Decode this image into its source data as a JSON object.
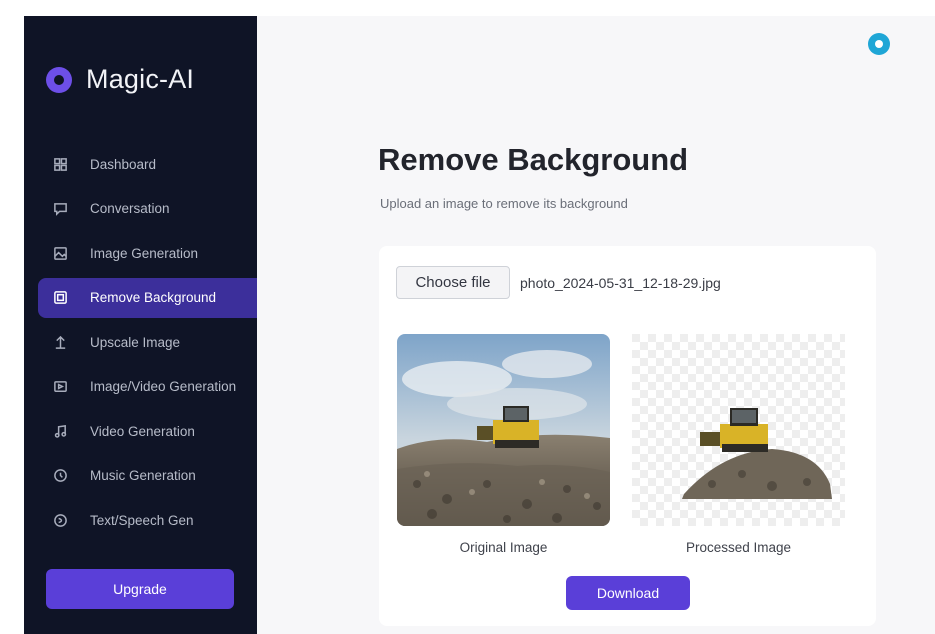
{
  "app": {
    "name": "Magic-AI",
    "logo_icon": "magic-ai-logo-icon"
  },
  "sidebar": {
    "items": [
      {
        "label": "Dashboard",
        "icon": "grid-icon",
        "active": false
      },
      {
        "label": "Conversation",
        "icon": "chat-icon",
        "active": false
      },
      {
        "label": "Image Generation",
        "icon": "image-icon",
        "active": false
      },
      {
        "label": "Remove Background",
        "icon": "image-frame-icon",
        "active": true
      },
      {
        "label": "Upscale Image",
        "icon": "upload-arrow-icon",
        "active": false
      },
      {
        "label": "Image/Video Generation",
        "icon": "video-frame-icon",
        "active": false
      },
      {
        "label": "Video Generation",
        "icon": "music-note-icon",
        "active": false
      },
      {
        "label": "Music Generation",
        "icon": "clock-icon",
        "active": false
      },
      {
        "label": "Text/Speech Gen",
        "icon": "speech-icon",
        "active": false
      }
    ],
    "upgrade_label": "Upgrade"
  },
  "main": {
    "title": "Remove Background",
    "subtitle": "Upload an image to remove its background",
    "file_input": {
      "button_label": "Choose file",
      "file_name": "photo_2024-05-31_12-18-29.jpg"
    },
    "original_caption": "Original Image",
    "processed_caption": "Processed Image",
    "download_label": "Download"
  },
  "colors": {
    "sidebar_bg": "#0f1426",
    "accent": "#5a3fd8",
    "active_item_bg": "#3c2f9b",
    "badge": "#1fa6d6",
    "main_bg": "#f7f7f9"
  }
}
